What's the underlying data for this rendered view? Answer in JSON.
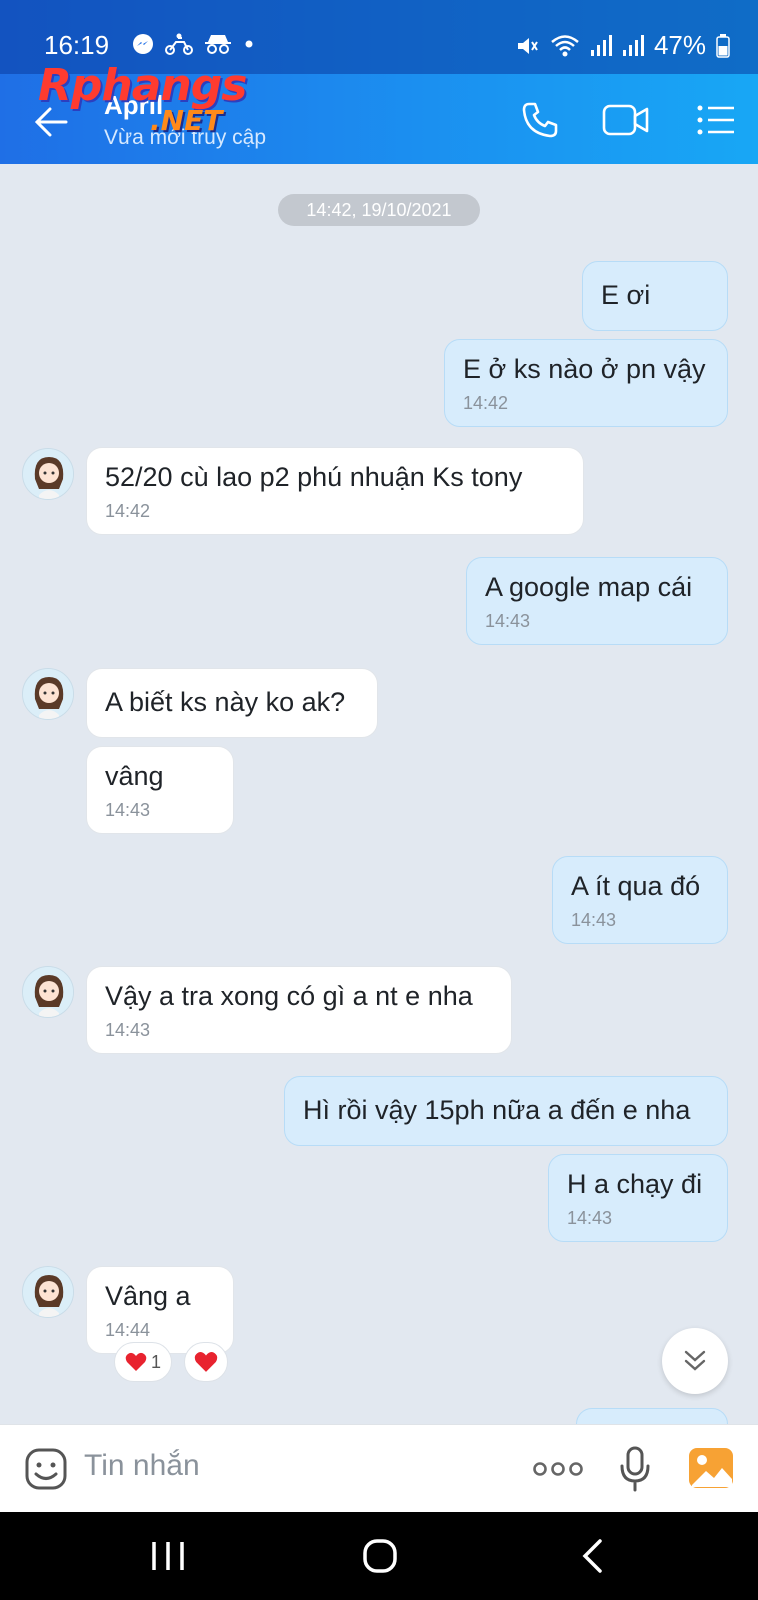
{
  "status_bar": {
    "time": "16:19",
    "battery": "47%"
  },
  "header": {
    "contact_name": "April",
    "contact_status": "Vừa mới truy cập",
    "watermark_top": "Rphangs",
    "watermark_bottom": ".NET"
  },
  "chat": {
    "date_separator": "14:42, 19/10/2021",
    "messages": [
      {
        "dir": "out",
        "text": "E ơi",
        "time": ""
      },
      {
        "dir": "out",
        "text": "E ở ks nào ở pn vậy",
        "time": "14:42"
      },
      {
        "dir": "in",
        "text": "52/20 cù lao p2 phú nhuận Ks tony",
        "time": "14:42"
      },
      {
        "dir": "out",
        "text": "A google map cái",
        "time": "14:43"
      },
      {
        "dir": "in",
        "text": "A biết ks này ko ak?",
        "time": ""
      },
      {
        "dir": "in",
        "text": "vâng",
        "time": "14:43"
      },
      {
        "dir": "out",
        "text": "A ít qua đó",
        "time": "14:43"
      },
      {
        "dir": "in",
        "text": "Vậy a tra xong có gì a nt e nha",
        "time": "14:43"
      },
      {
        "dir": "out",
        "text": "Hì rồi vậy 15ph nữa a đến e nha",
        "time": ""
      },
      {
        "dir": "out",
        "text": "H a chạy đi",
        "time": "14:43"
      },
      {
        "dir": "in",
        "text": "Vâng a",
        "time": "14:44"
      }
    ],
    "reaction_count": "1"
  },
  "composer": {
    "placeholder": "Tin nhắn"
  },
  "colors": {
    "header_gradient_start": "#1f6fe6",
    "header_gradient_end": "#18a7f5",
    "outgoing_bubble": "#d7ecfc",
    "incoming_bubble": "#ffffff",
    "chat_background": "#e2e8f0"
  },
  "icons": [
    "messenger-icon",
    "motorbike-icon",
    "incognito-icon",
    "mute-icon",
    "wifi-icon",
    "signal-icon",
    "battery-icon",
    "back-arrow-icon",
    "phone-icon",
    "video-icon",
    "menu-list-icon",
    "sticker-icon",
    "more-dots-icon",
    "microphone-icon",
    "image-icon",
    "chevron-double-down-icon",
    "recent-apps-icon",
    "home-icon",
    "nav-back-icon"
  ]
}
